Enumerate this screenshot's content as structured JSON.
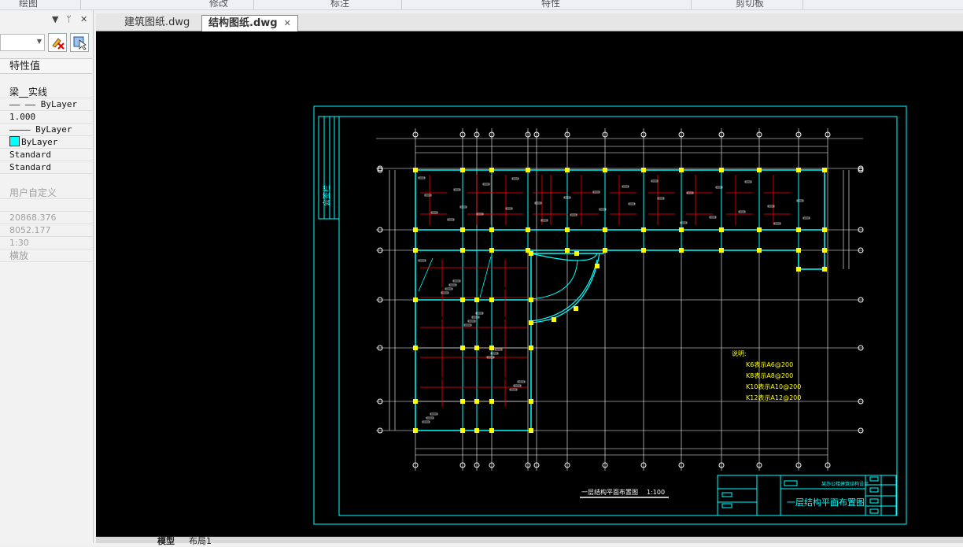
{
  "ribbon": {
    "groups": [
      "绘图",
      "修改",
      "标注",
      "特性",
      "剪切板"
    ]
  },
  "panel": {
    "pin_glyph": "ᛘ",
    "close_glyph": "✕",
    "collapse_glyph": "▼",
    "header": "特性值",
    "rows": [
      "梁__实线",
      "—— —— ByLayer",
      "1.000",
      "———— ByLayer",
      "ByLayer",
      "Standard",
      "Standard",
      "用户自定义",
      "",
      "20868.376",
      "8052.177",
      "1:30",
      "横放"
    ]
  },
  "tabs": [
    {
      "label": "建筑图纸.dwg",
      "active": false
    },
    {
      "label": "结构图纸.dwg",
      "active": true
    }
  ],
  "tab_close": "✕",
  "drawing": {
    "title_label": "一层结构平面布置图",
    "scale_label": "1:100",
    "titleblock_main": "一层结构平面布置图",
    "titleblock_sub": "某办公楼建筑结构设计",
    "side_label": "会签栏",
    "note_header": "说明:",
    "notes": [
      "K6表示A6@200",
      "K8表示A8@200",
      "K10表示A10@200",
      "K12表示A12@200"
    ]
  },
  "bottom_tabs": [
    "模型",
    "布局1"
  ],
  "colors": {
    "cyan": "#00ffff",
    "red": "#ff0000",
    "yellow": "#ffff00",
    "white": "#ffffff"
  }
}
